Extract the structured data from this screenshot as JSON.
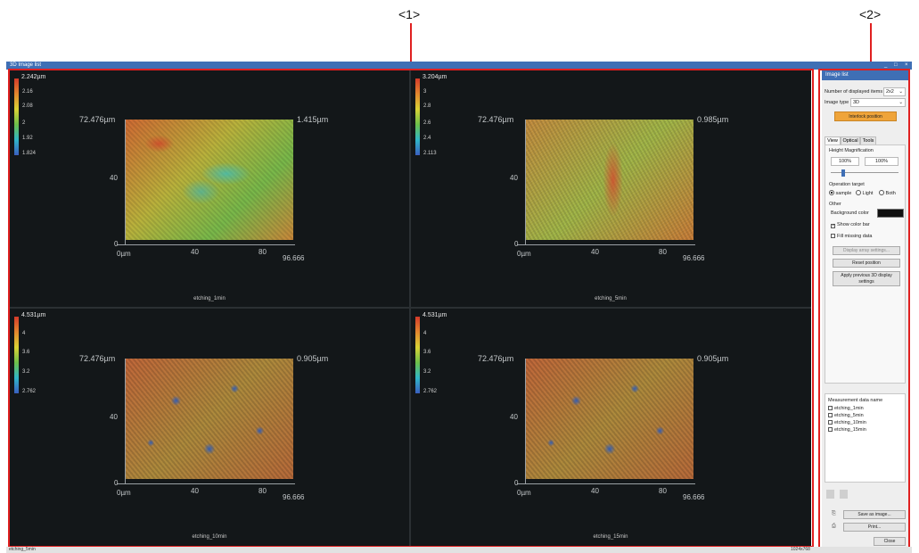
{
  "callouts": [
    "<1>",
    "<2>"
  ],
  "window": {
    "title": "3D Image list",
    "buttons": [
      "_",
      "□",
      "×"
    ]
  },
  "panes": [
    {
      "name": "etching_1min",
      "colorbar_top": "2.242µm",
      "colorbar_ticks": [
        "2.16",
        "2.08",
        "2",
        "1.92",
        "1.824"
      ],
      "y_top": "72.476µm",
      "z_label": "1.415µm",
      "y_mid": "40",
      "y_zero": "0",
      "x_start": "0µm",
      "x_mid1": "40",
      "x_mid2": "80",
      "x_end": "96.666"
    },
    {
      "name": "etching_5min",
      "colorbar_top": "3.204µm",
      "colorbar_ticks": [
        "3",
        "2.8",
        "2.6",
        "2.4",
        "2.113"
      ],
      "y_top": "72.476µm",
      "z_label": "0.985µm",
      "y_mid": "40",
      "y_zero": "0",
      "x_start": "0µm",
      "x_mid1": "40",
      "x_mid2": "80",
      "x_end": "96.666"
    },
    {
      "name": "etching_10min",
      "colorbar_top": "4.531µm",
      "colorbar_ticks": [
        "4",
        "3.6",
        "3.2",
        "2.762"
      ],
      "y_top": "72.476µm",
      "z_label": "0.905µm",
      "y_mid": "40",
      "y_zero": "0",
      "x_start": "0µm",
      "x_mid1": "40",
      "x_mid2": "80",
      "x_end": "96.666"
    },
    {
      "name": "etching_15min",
      "colorbar_top": "4.531µm",
      "colorbar_ticks": [
        "4",
        "3.6",
        "3.2",
        "2.762"
      ],
      "y_top": "72.476µm",
      "z_label": "0.905µm",
      "y_mid": "40",
      "y_zero": "0",
      "x_start": "0µm",
      "x_mid1": "40",
      "x_mid2": "80",
      "x_end": "96.666"
    }
  ],
  "panel": {
    "header": "Image list",
    "num_items_label": "Number of displayed items",
    "num_items_value": "2x2",
    "image_type_label": "Image type",
    "image_type_value": "3D",
    "interlock_button": "Interlock position",
    "tabs": [
      "View",
      "Optical",
      "Tools"
    ],
    "height_mag_label": "Height Magnification",
    "mag_value1": "100%",
    "mag_value2": "100%",
    "operation_target_label": "Operation target",
    "radio_options": [
      "sample",
      "Light",
      "Both"
    ],
    "other_label": "Other",
    "background_color_label": "Background color",
    "show_color_bar_label": "Show color bar",
    "fill_missing_label": "Fill missing data",
    "display_array_button": "Display array settings...",
    "reset_position_button": "Reset position",
    "apply_previous_button_line1": "Apply previous 3D display",
    "apply_previous_button_line2": "settings",
    "measurement_data_label": "Measurement data name",
    "measurement_items": [
      "etching_1min",
      "etching_5min",
      "etching_10min",
      "etching_15min"
    ],
    "save_as_image_button": "Save as image...",
    "print_button": "Print...",
    "close_button": "Close"
  },
  "status": {
    "left": "etching_5min",
    "right": "1024x768"
  },
  "colors": {
    "highlight": "#e02020",
    "titlebar": "#3f6fb5",
    "accent_button": "#efa43a"
  }
}
